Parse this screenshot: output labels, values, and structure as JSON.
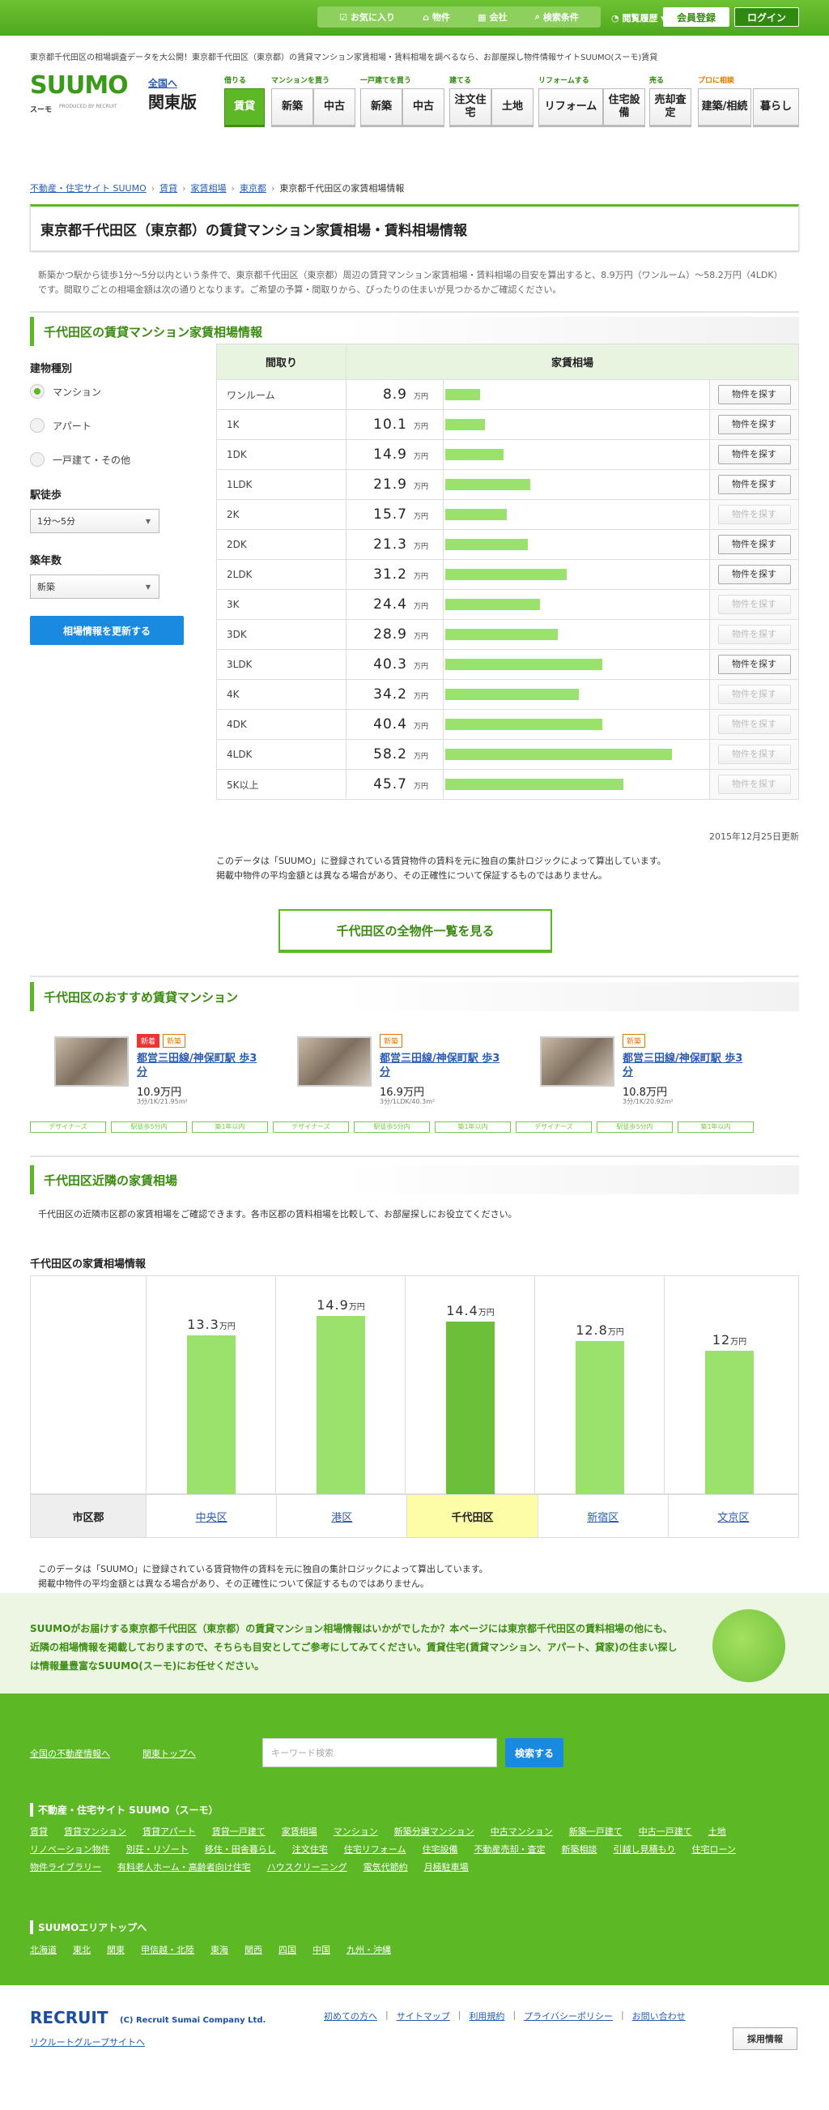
{
  "topbar": {
    "favorites": "お気に入り",
    "properties": "物件",
    "companies": "会社",
    "conditions": "検索条件",
    "history": "閲覧履歴",
    "register": "会員登録",
    "login": "ログイン"
  },
  "header": {
    "tagline": "東京都千代田区の相場調査データを大公開！東京都千代田区（東京都）の賃貸マンション家賃相場・賃料相場を調べるなら、お部屋探し物件情報サイトSUUMO(スーモ)賃貸",
    "logo": "SUUMO",
    "logo_sub": "スーモ",
    "logo_by": "PRODUCED BY RECRUIT",
    "area_link": "全国へ",
    "area_name": "関東版"
  },
  "nav": {
    "categories": [
      "借りる",
      "マンションを買う",
      "一戸建てを買う",
      "建てる",
      "リフォームする",
      "売る",
      "プロに相談"
    ],
    "items": [
      "賃貸",
      "新築",
      "中古",
      "新築",
      "中古",
      "注文住宅",
      "土地",
      "リフォーム",
      "住宅設備",
      "売却査定",
      "建築/相続",
      "暮らし"
    ]
  },
  "breadcrumb": [
    "不動産・住宅サイト SUUMO",
    "賃貸",
    "家賃相場",
    "東京都",
    "東京都千代田区の家賃相場情報"
  ],
  "page_title": "東京都千代田区（東京都）の賃貸マンション家賃相場・賃料相場情報",
  "intro": "新築かつ駅から徒歩1分〜5分以内という条件で、東京都千代田区（東京都）周辺の賃貸マンション家賃相場・賃料相場の目安を算出すると、8.9万円（ワンルーム）〜58.2万円（4LDK）です。間取りごとの相場金額は次の通りとなります。ご希望の予算・間取りから、ぴったりの住まいが見つかるかご確認ください。",
  "section1": "千代田区の賃貸マンション家賃相場情報",
  "filters": {
    "type_label": "建物種別",
    "types": [
      "マンション",
      "アパート",
      "一戸建て・その他"
    ],
    "walk_label": "駅徒歩",
    "walk_value": "1分〜5分",
    "age_label": "築年数",
    "age_value": "新築",
    "update_button": "相場情報を更新する"
  },
  "table": {
    "headers": [
      "間取り",
      "家賃相場"
    ],
    "unit": "万円",
    "find_label": "物件を探す",
    "rows": [
      {
        "layout": "ワンルーム",
        "value": "8.9",
        "active": true
      },
      {
        "layout": "1K",
        "value": "10.1",
        "active": true
      },
      {
        "layout": "1DK",
        "value": "14.9",
        "active": true
      },
      {
        "layout": "1LDK",
        "value": "21.9",
        "active": true
      },
      {
        "layout": "2K",
        "value": "15.7",
        "active": false
      },
      {
        "layout": "2DK",
        "value": "21.3",
        "active": true
      },
      {
        "layout": "2LDK",
        "value": "31.2",
        "active": true
      },
      {
        "layout": "3K",
        "value": "24.4",
        "active": false
      },
      {
        "layout": "3DK",
        "value": "28.9",
        "active": false
      },
      {
        "layout": "3LDK",
        "value": "40.3",
        "active": true
      },
      {
        "layout": "4K",
        "value": "34.2",
        "active": false
      },
      {
        "layout": "4DK",
        "value": "40.4",
        "active": false
      },
      {
        "layout": "4LDK",
        "value": "58.2",
        "active": false
      },
      {
        "layout": "5K以上",
        "value": "45.7",
        "active": false
      }
    ],
    "updated": "2015年12月25日更新"
  },
  "note1": "このデータは「SUUMO」に登録されている賃貸物件の賃料を元に独自の集計ロジックによって算出しています。",
  "note2": "掲載中物件の平均金額とは異なる場合があり、その正確性について保証するものではありません。",
  "all_button": "千代田区の全物件一覧を見る",
  "section2": "千代田区のおすすめ賃貸マンション",
  "properties": [
    {
      "badges": [
        "新着",
        "新築"
      ],
      "name": "都営三田線/神保町駅 歩3分",
      "price": "10.9万円",
      "spec": "3分/1K/21.95m²",
      "tags": [
        "デザイナーズ",
        "駅徒歩5分内",
        "築1年以内"
      ]
    },
    {
      "badges": [
        "新築"
      ],
      "name": "都営三田線/神保町駅 歩3分",
      "price": "16.9万円",
      "spec": "3分/1LDK/40.3m²",
      "tags": [
        "デザイナーズ",
        "駅徒歩5分内",
        "築1年以内"
      ]
    },
    {
      "badges": [
        "新築"
      ],
      "name": "都営三田線/神保町駅 歩3分",
      "price": "10.8万円",
      "spec": "3分/1K/20.92m²",
      "tags": [
        "デザイナーズ",
        "駅徒歩5分内",
        "築1年以内"
      ]
    }
  ],
  "section3": "千代田区近隣の家賃相場",
  "section3_text": "千代田区の近隣市区郡の家賃相場をご確認できます。各市区郡の賃料相場を比較して、お部屋探しにお役立てください。",
  "chart_data": {
    "type": "bar",
    "title": "千代田区の家賃相場情報",
    "xlabel": "市区郡",
    "unit": "万円",
    "categories": [
      "中央区",
      "港区",
      "千代田区",
      "新宿区",
      "文京区"
    ],
    "values": [
      13.3,
      14.9,
      14.4,
      12.8,
      12.0
    ],
    "highlight": "千代田区",
    "bar_color": "#9ae26c",
    "highlight_color": "#6cbf39"
  },
  "note3": "このデータは「SUUMO」に登録されている賃貸物件の賃料を元に独自の集計ロジックによって算出しています。",
  "note4": "掲載中物件の平均金額とは異なる場合があり、その正確性について保証するものではありません。",
  "banner": "SUUMOがお届けする東京都千代田区（東京都）の賃貸マンション相場情報はいかがでしたか？本ページには東京都千代田区の賃料相場の他にも、近隣の相場情報を掲載しておりますので、そちらも目安としてご参考にしてみてください。賃貸住宅(賃貸マンション、アパート、貸家)の住まい探しは情報量豊富なSUUMO(スーモ)にお任せください。",
  "footer": {
    "link_all": "全国の不動産情報へ",
    "link_top": "関東トップへ",
    "search_placeholder": "キーワード検索",
    "search_button": "検索する",
    "site_head": "不動産・住宅サイト SUUMO（スーモ）",
    "site_links": [
      "賃貸",
      "賃貸マンション",
      "賃貸アパート",
      "賃貸一戸建て",
      "家賃相場",
      "マンション",
      "新築分譲マンション",
      "中古マンション",
      "新築一戸建て",
      "中古一戸建て",
      "土地",
      "リノベーション物件",
      "別荘・リゾート",
      "移住・田舎暮らし",
      "注文住宅",
      "住宅リフォーム",
      "住宅設備",
      "不動産売却・査定",
      "新築相談",
      "引越し見積もり",
      "住宅ローン",
      "物件ライブラリー",
      "有料老人ホーム・高齢者向け住宅",
      "ハウスクリーニング",
      "電気代節約",
      "月極駐車場"
    ],
    "area_head": "SUUMOエリアトップへ",
    "area_links": [
      "北海道",
      "東北",
      "関東",
      "甲信越・北陸",
      "東海",
      "関西",
      "四国",
      "中国",
      "九州・沖縄"
    ],
    "recruit_logo": "RECRUIT",
    "copyright": "(C) Recruit Sumai Company Ltd.",
    "group_link": "リクルートグループサイトへ",
    "bottom_links": [
      "初めての方へ",
      "サイトマップ",
      "利用規約",
      "プライバシーポリシー",
      "お問い合わせ"
    ],
    "recruit_button": "採用情報"
  }
}
